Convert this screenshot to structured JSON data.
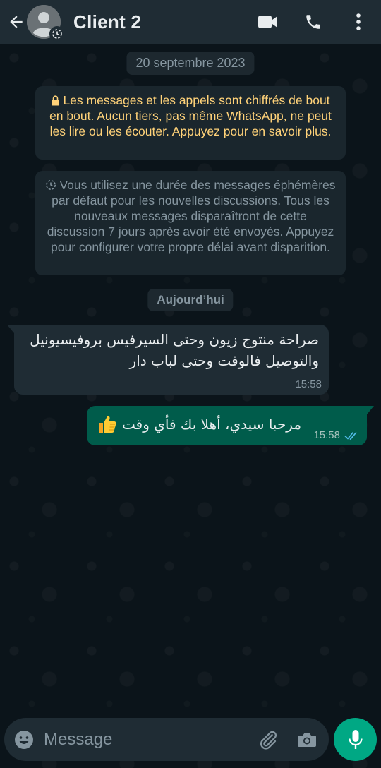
{
  "header": {
    "contact_name": "Client 2",
    "icons": [
      "arrow-back-icon",
      "avatar",
      "disappearing-timer-icon",
      "video-call-icon",
      "phone-icon",
      "more-vert-icon"
    ]
  },
  "dates": {
    "first": "20 septembre 2023",
    "today": "Aujourd’hui"
  },
  "system_messages": {
    "encryption": "Les messages et les appels sont chiffrés de bout en bout. Aucun tiers, pas même WhatsApp, ne peut les lire ou les écouter. Appuyez pour en savoir plus.",
    "ephemeral": "Vous utilisez une durée des messages éphémères par défaut pour les nouvelles discussions. Tous les nouveaux messages disparaîtront de cette discussion 7 jours après avoir été envoyés. Appuyez pour configurer votre propre délai avant disparition."
  },
  "messages": [
    {
      "direction": "incoming",
      "text": "صراحة منتوج زيون وحتى السيرفيس بروفيسيونيل والتوصيل فالوقت وحتى لباب دار",
      "time": "15:58"
    },
    {
      "direction": "outgoing",
      "text": "مرحبا سيدي، أهلا بك فأي وقت",
      "emoji": "thumbs-up",
      "time": "15:58",
      "status": "read"
    }
  ],
  "composer": {
    "placeholder": "Message"
  },
  "colors": {
    "header_bg": "#1f2c34",
    "chat_bg": "#0b141a",
    "outgoing_bubble": "#005c4b",
    "incoming_bubble": "#1f2c34",
    "accent_green": "#00a884",
    "encryption_text": "#ffd279",
    "read_ticks": "#53bdeb"
  }
}
